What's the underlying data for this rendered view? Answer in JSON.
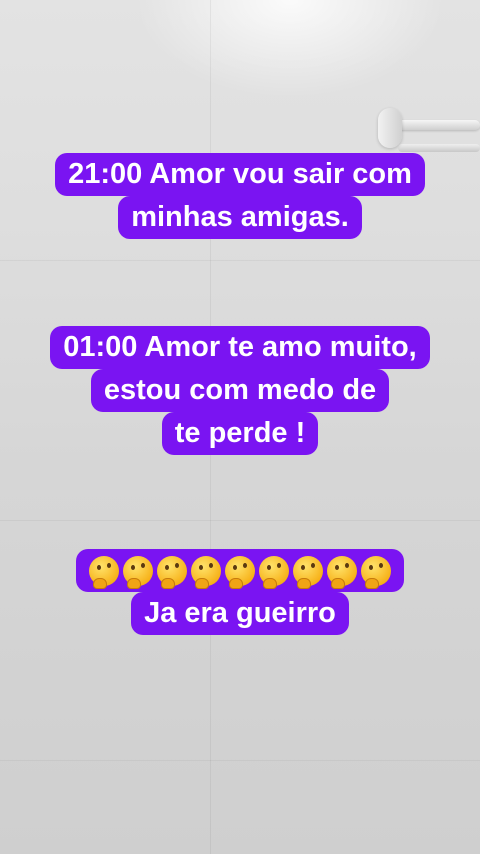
{
  "messages": [
    {
      "lines": [
        "21:00 Amor vou sair com",
        "minhas amigas."
      ]
    },
    {
      "lines": [
        "01:00 Amor te amo muito,",
        "estou com medo de",
        "te perde !"
      ]
    },
    {
      "emoji_icon": "thinking-face-icon",
      "emoji_count": 9,
      "lines": [
        "Ja era gueirro"
      ]
    }
  ],
  "colors": {
    "caption_background": "#7a14f2",
    "caption_text": "#ffffff",
    "wall": "#d9d9d9"
  }
}
